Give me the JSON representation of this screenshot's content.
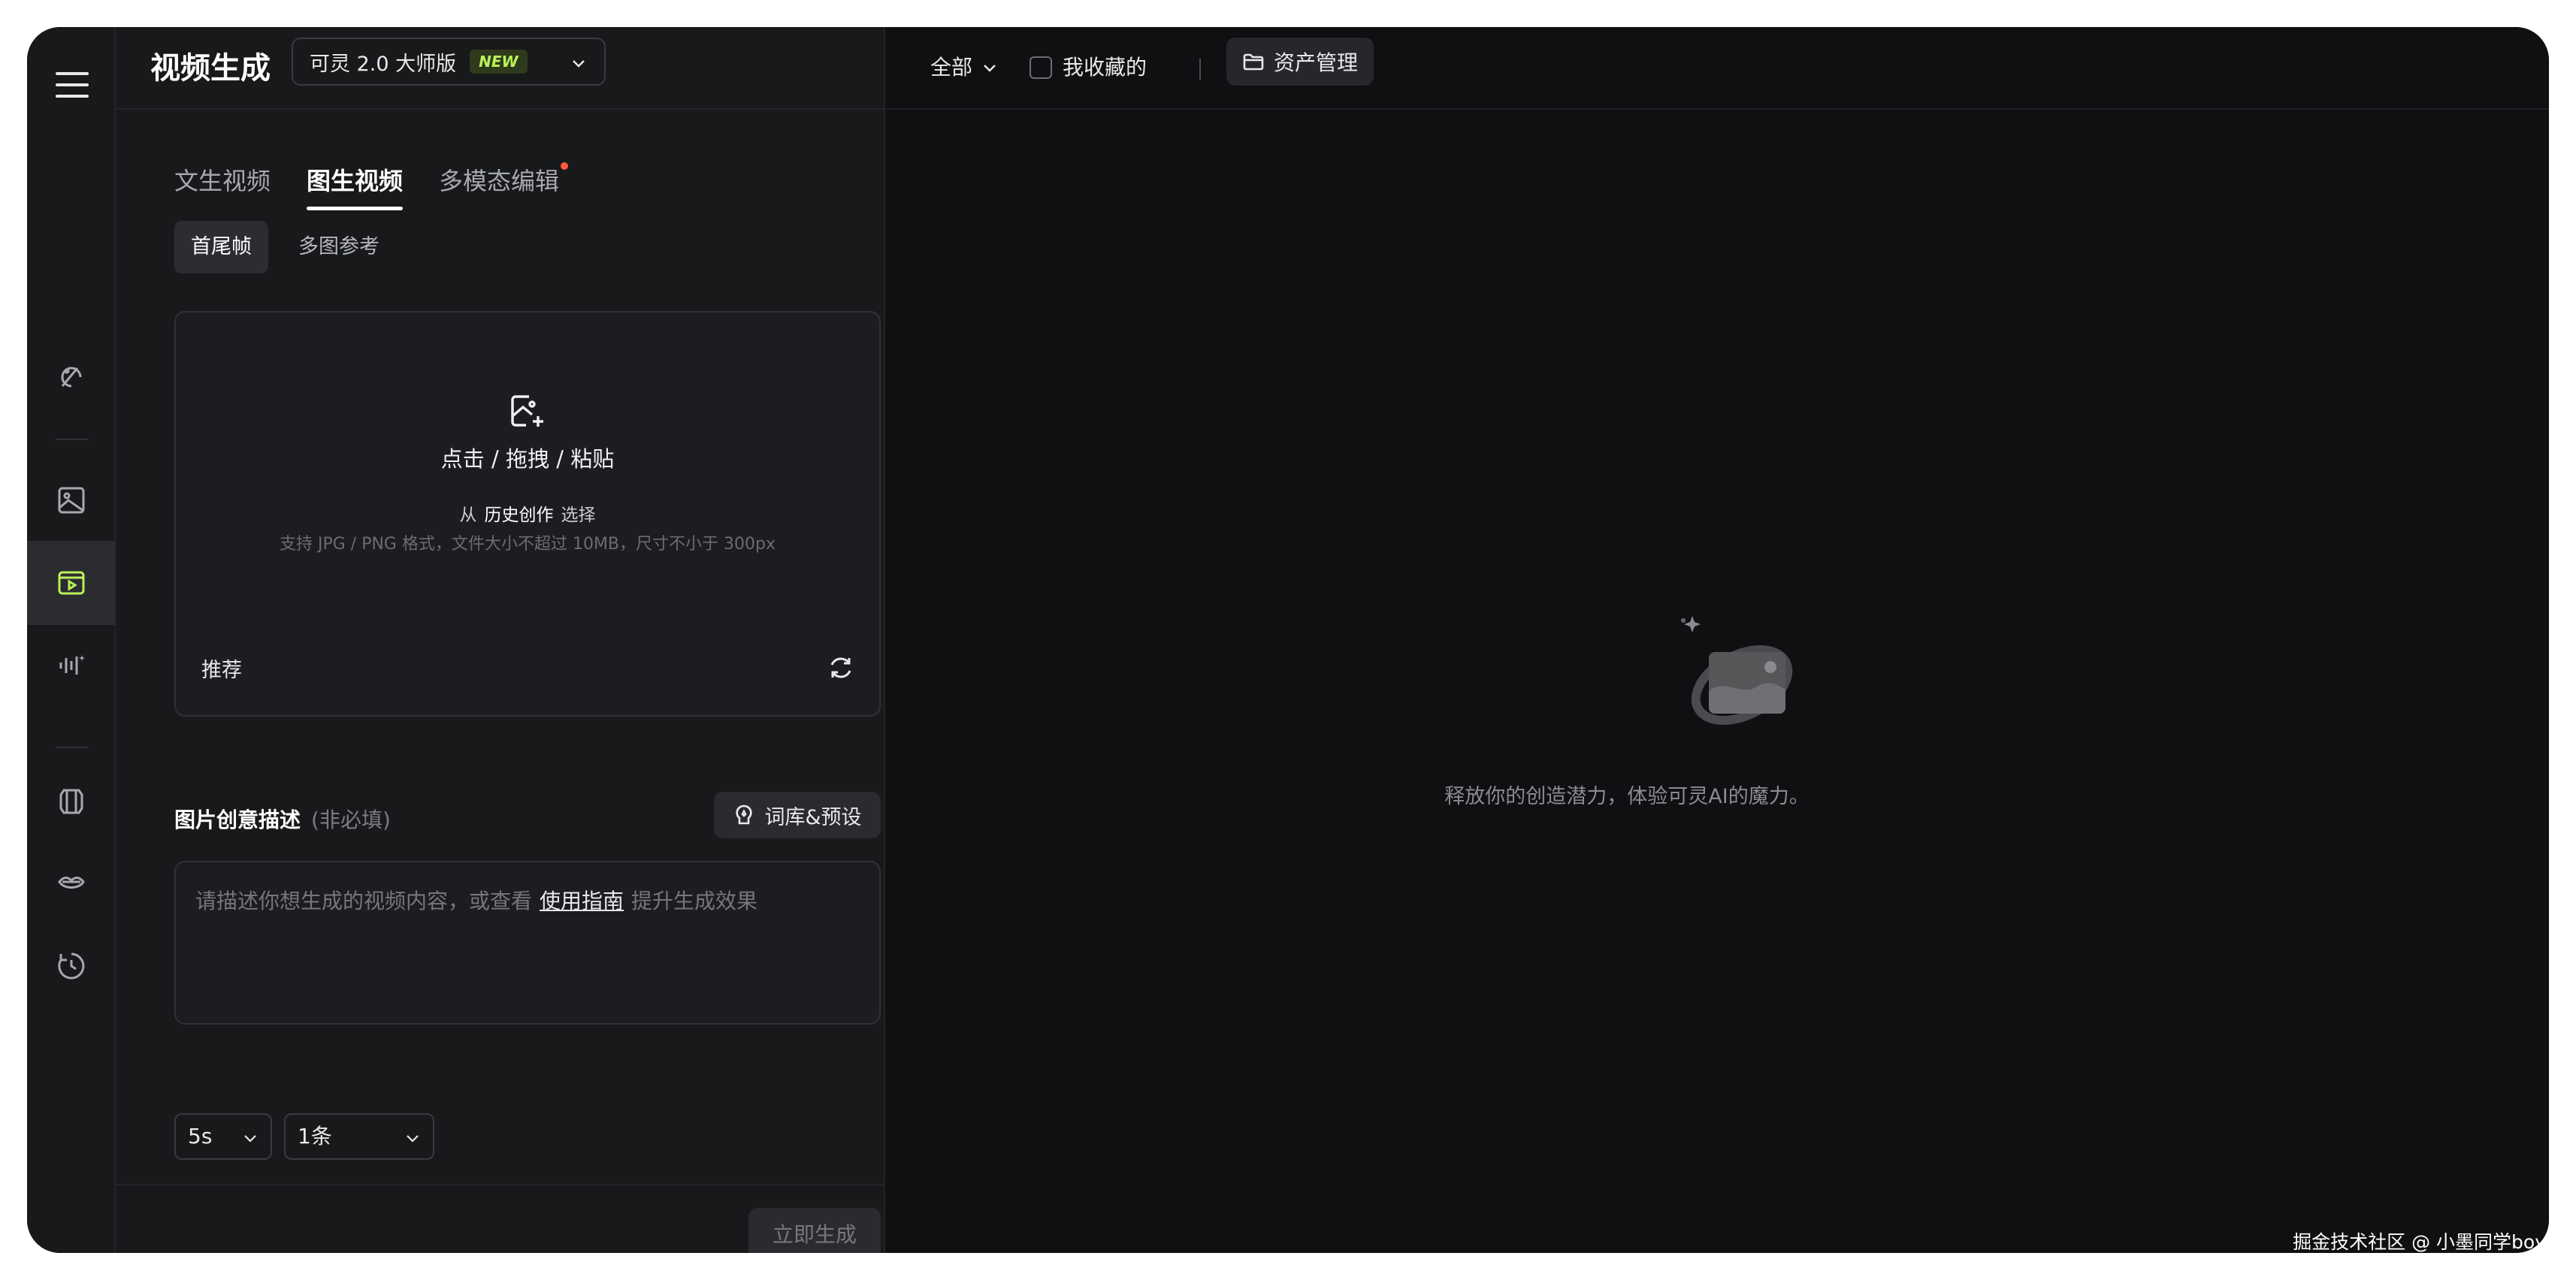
{
  "rail": {
    "items": [
      "ai-creative-icon",
      "image-icon",
      "video-icon",
      "audio-icon",
      "character-icon",
      "lip-sync-icon",
      "history-icon"
    ],
    "active": "video-icon"
  },
  "header": {
    "title": "视频生成",
    "model_label": "可灵 2.0 大师版",
    "model_badge": "NEW"
  },
  "tabs": [
    {
      "label": "文生视频",
      "active": false
    },
    {
      "label": "图生视频",
      "active": true
    },
    {
      "label": "多模态编辑",
      "active": false,
      "has_dot": true
    }
  ],
  "subtabs": [
    {
      "label": "首尾帧",
      "active": true
    },
    {
      "label": "多图参考",
      "active": false
    }
  ],
  "upload": {
    "main": "点击 / 拖拽 / 粘贴",
    "from": "从",
    "history": "历史创作",
    "choose": "选择",
    "hint": "支持 JPG / PNG 格式，文件大小不超过 10MB，尺寸不小于 300px",
    "recommend": "推荐"
  },
  "description": {
    "label": "图片创意描述",
    "optional": "(非必填)",
    "library_button": "词库&预设",
    "placeholder_before": "请描述你想生成的视频内容，或查看",
    "guide_link": "使用指南",
    "placeholder_after": "提升生成效果"
  },
  "settings": {
    "duration": "5s",
    "count": "1条"
  },
  "generate_button": "立即生成",
  "toolbar": {
    "filter": "全部",
    "favorites": "我收藏的",
    "asset_button": "资产管理"
  },
  "empty_state": "释放你的创造潜力，体验可灵AI的魔力。",
  "watermark": "掘金技术社区 @ 小墨同学boy",
  "colors": {
    "accent": "#b9f15a",
    "background": "#0f1011",
    "panel": "#18191b"
  }
}
